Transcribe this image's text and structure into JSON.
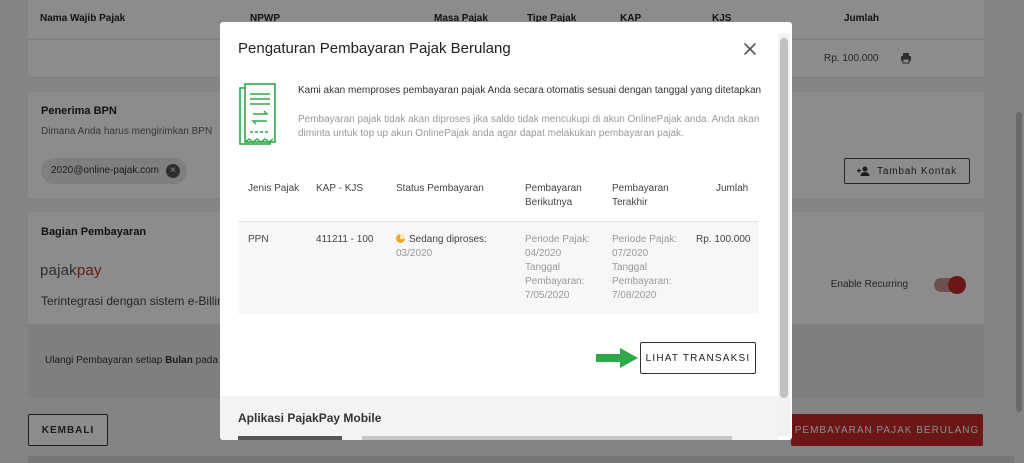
{
  "background": {
    "table_headers": [
      "Nama Wajib Pajak",
      "NPWP",
      "Masa Pajak",
      "Tipe Pajak",
      "KAP",
      "KJS",
      "Jumlah"
    ],
    "row_amount": "Rp. 100.000",
    "recipient": {
      "title": "Penerima BPN",
      "description": "Dimana Anda harus mengirimkan BPN",
      "email_chip": "2020@online-pajak.com",
      "add_contact_label": "Tambah Kontak"
    },
    "payment": {
      "title": "Bagian Pembayaran",
      "logo_text_a": "pajak",
      "logo_text_b": "pay",
      "description": "Terintegrasi dengan sistem e-Billing",
      "enable_label": "Enable Recurring",
      "recurring_enabled": true
    },
    "repeat_text_a": "Ulangi Pembayaran setiap",
    "repeat_text_b": "Bulan",
    "repeat_text_c": "pada",
    "back_label": "KEMBALI",
    "recurring_button_label": "PEMBAYARAN PAJAK BERULANG"
  },
  "modal": {
    "title": "Pengaturan Pembayaran Pajak Berulang",
    "info_main": "Kami akan memproses pembayaran pajak Anda secara otomatis sesuai dengan tanggal yang ditetapkan",
    "info_sub": "Pembayaran pajak tidak akan diproses jika saldo tidak mencukupi di akun OnlinePajak anda. Anda akan diminta untuk top up akun OnlinePajak anda agar dapat melakukan pembayaran pajak.",
    "table": {
      "headers": {
        "jenis": "Jenis Pajak",
        "kap": "KAP - KJS",
        "status": "Status Pembayaran",
        "next": "Pembayaran Berikutnya",
        "last": "Pembayaran Terakhir",
        "amount": "Jumlah"
      },
      "row": {
        "jenis": "PPN",
        "kap": "411211 - 100",
        "status": "Sedang diproses:",
        "status_period": "03/2020",
        "next": "Periode Pajak: 04/2020 Tanggal Pembayaran: 7/05/2020",
        "last": "Periode Pajak: 07/2020 Tanggal Pembayaran: 7/08/2020",
        "amount": "Rp. 100.000"
      }
    },
    "view_button_label": "LIHAT TRANSAKSI",
    "mobile_title": "Aplikasi PajakPay Mobile"
  },
  "colors": {
    "brand_red": "#c62828",
    "accent_green": "#2ea84a",
    "status_orange": "#f5a623"
  },
  "icons": [
    "print-icon",
    "close-icon",
    "add-person-icon",
    "receipt-transfer-icon",
    "arrow-right-icon"
  ]
}
